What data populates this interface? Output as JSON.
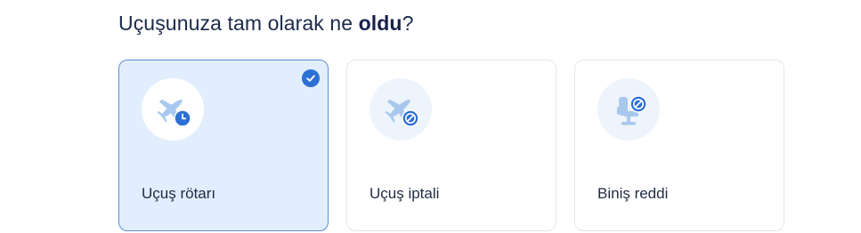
{
  "question": {
    "prefix": "Uçuşunuza tam olarak ne ",
    "emphasis": "oldu",
    "suffix": "?"
  },
  "options": [
    {
      "label": "Uçuş rötarı",
      "icon": "plane-delay-icon",
      "selected": true
    },
    {
      "label": "Uçuş iptali",
      "icon": "plane-cancel-icon",
      "selected": false
    },
    {
      "label": "Biniş reddi",
      "icon": "seat-denied-icon",
      "selected": false
    }
  ],
  "colors": {
    "accent": "#2c6fd5",
    "selected_bg": "#e2eefd",
    "icon_light": "#a9c8ee",
    "text": "#1f2a44"
  }
}
